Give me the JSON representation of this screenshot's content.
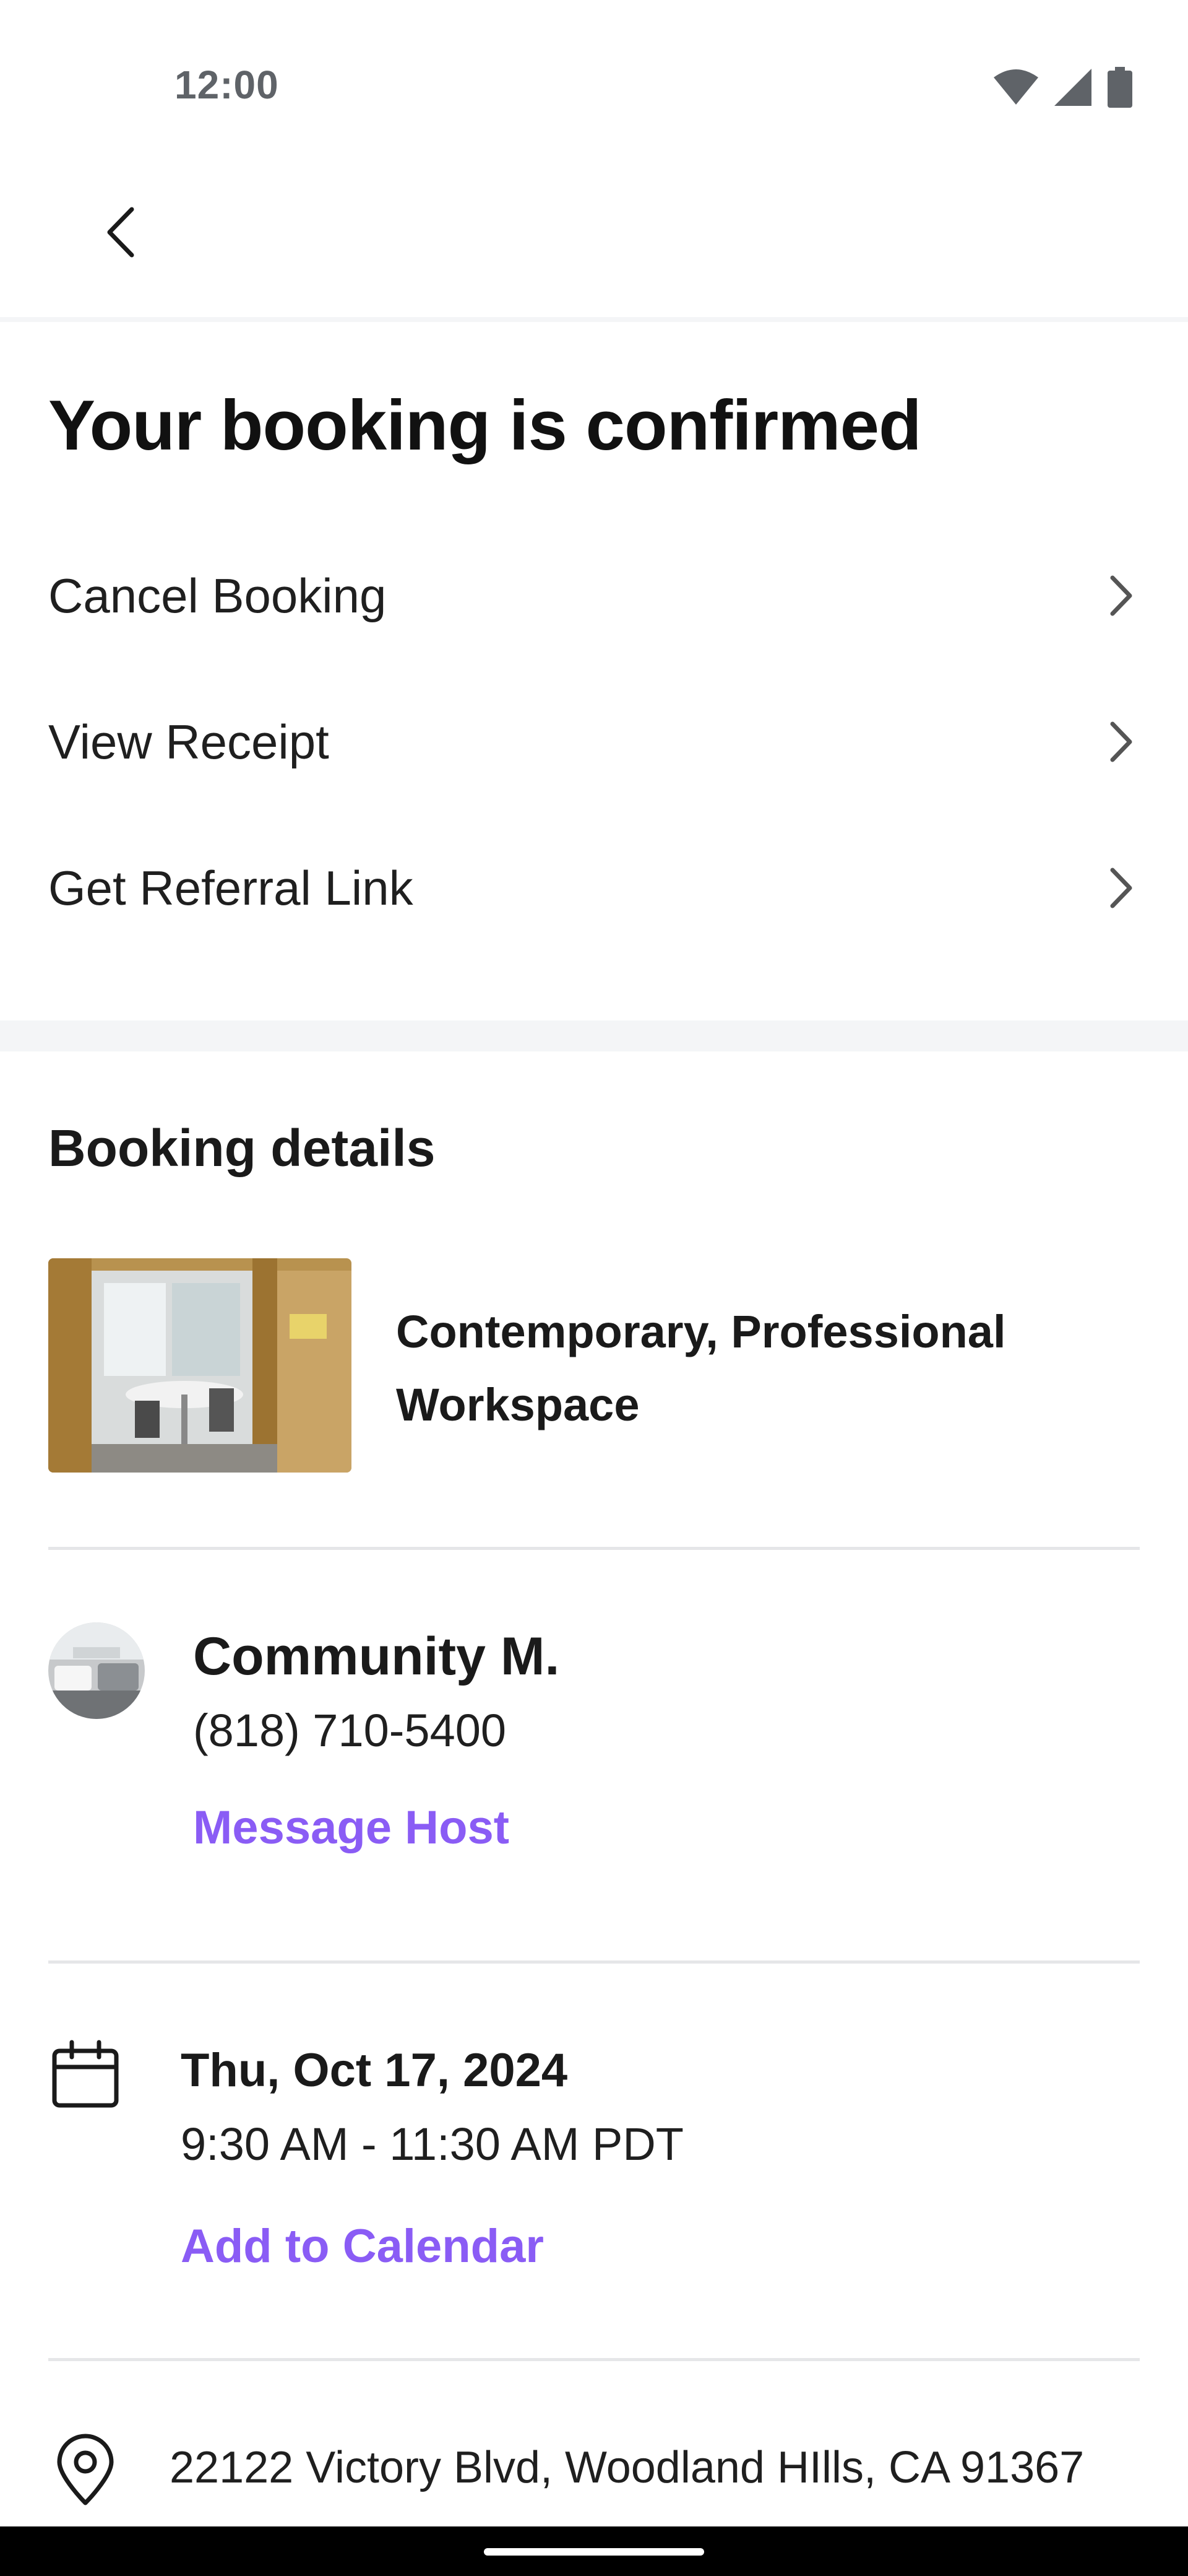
{
  "status_bar": {
    "time": "12:00",
    "icons": [
      "wifi-icon",
      "signal-icon",
      "battery-icon"
    ]
  },
  "header": {
    "back_icon": "chevron-left-icon"
  },
  "title": "Your booking is confirmed",
  "actions": [
    {
      "label": "Cancel Booking",
      "icon": "chevron-right-icon"
    },
    {
      "label": "View Receipt",
      "icon": "chevron-right-icon"
    },
    {
      "label": "Get Referral Link",
      "icon": "chevron-right-icon"
    }
  ],
  "details": {
    "section_title": "Booking details",
    "listing": {
      "name": "Contemporary, Professional Workspace",
      "image": "office-room-photo"
    },
    "host": {
      "name": "Community M.",
      "phone": "(818) 710-5400",
      "message_label": "Message Host",
      "avatar": "lounge-photo"
    },
    "schedule": {
      "date": "Thu, Oct 17, 2024",
      "time": "9:30 AM - 11:30 AM PDT",
      "add_calendar_label": "Add to Calendar",
      "icon": "calendar-icon"
    },
    "location": {
      "address": "22122 Victory Blvd, Woodland HIlls, CA 91367",
      "icon": "location-pin-icon"
    }
  },
  "colors": {
    "accent": "#8a5cf5",
    "text": "#1a1a1a",
    "divider": "#e5e6e8",
    "band": "#f4f5f7"
  }
}
